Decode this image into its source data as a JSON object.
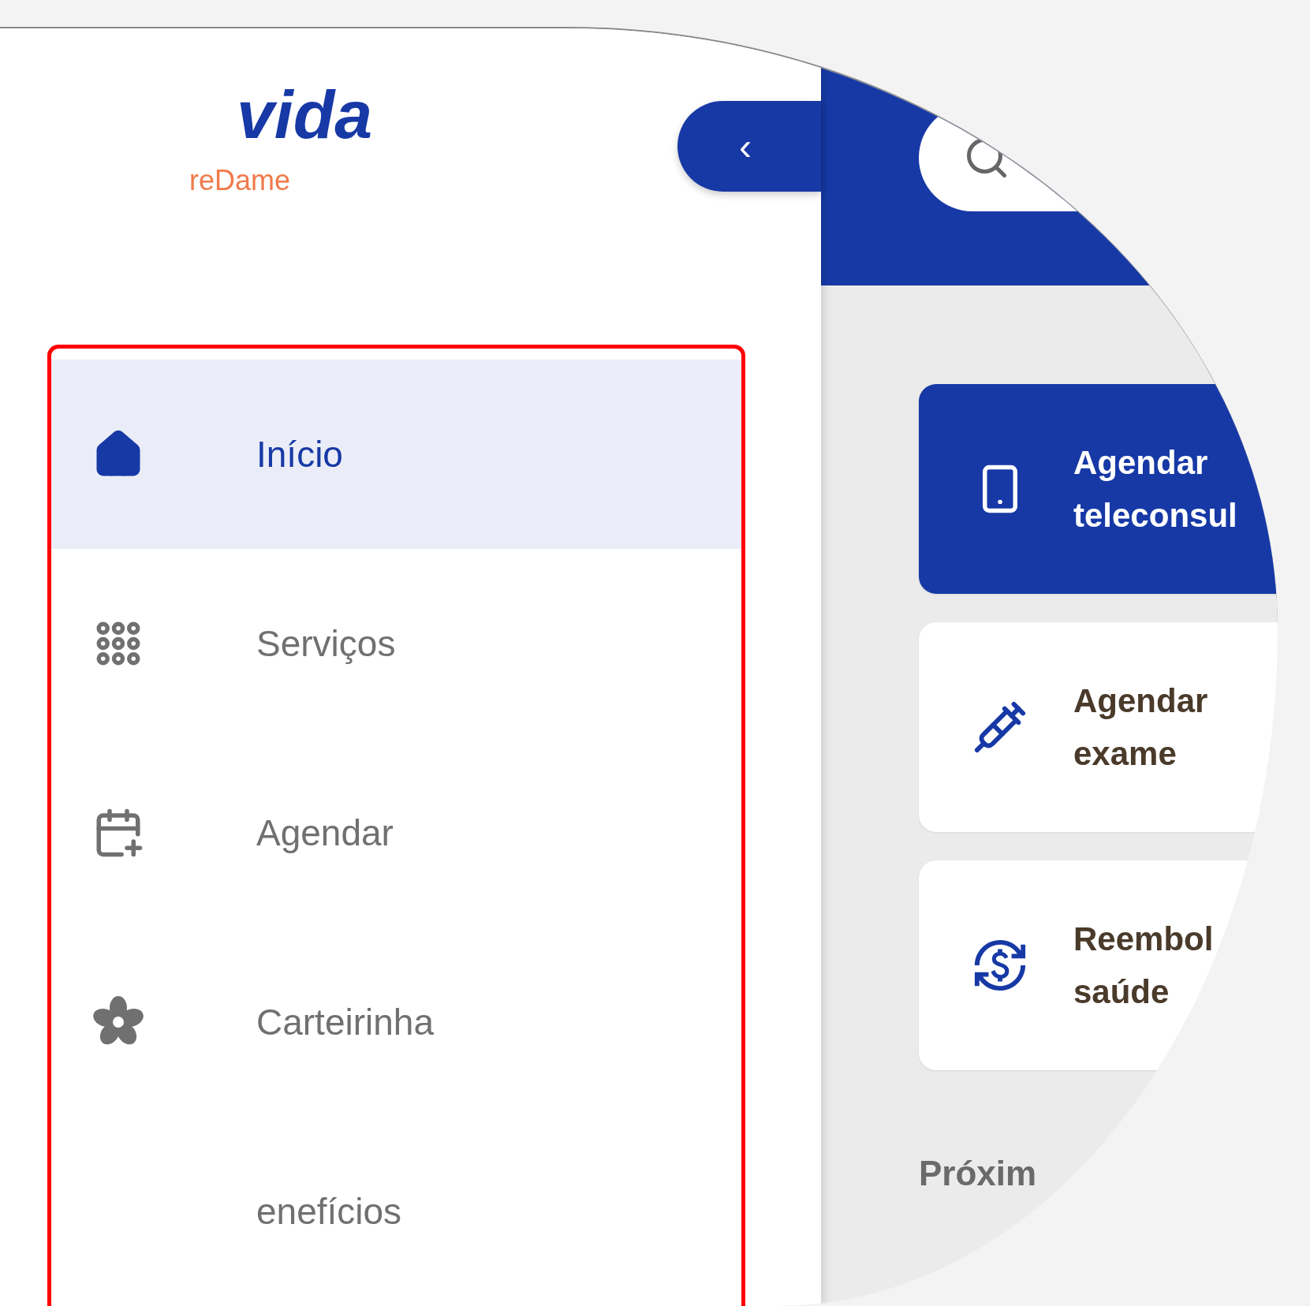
{
  "logo": {
    "wordmark": "vida",
    "tagline": "reDame"
  },
  "collapse_button": {
    "label": "‹"
  },
  "nav": [
    {
      "kind": "home",
      "label": "Início",
      "selected": true
    },
    {
      "kind": "grid",
      "label": "Serviços",
      "selected": false
    },
    {
      "kind": "calendar",
      "label": "Agendar",
      "selected": false
    },
    {
      "kind": "card",
      "label": "Carteirinha",
      "selected": false
    },
    {
      "kind": "none",
      "label": "enefícios",
      "selected": false
    }
  ],
  "actions": [
    {
      "kind": "primary",
      "label": "Agendar teleconsul"
    },
    {
      "kind": "default",
      "label": "Agendar exame"
    },
    {
      "kind": "default",
      "label": "Reembol saúde"
    }
  ],
  "section_title": "Próxim"
}
